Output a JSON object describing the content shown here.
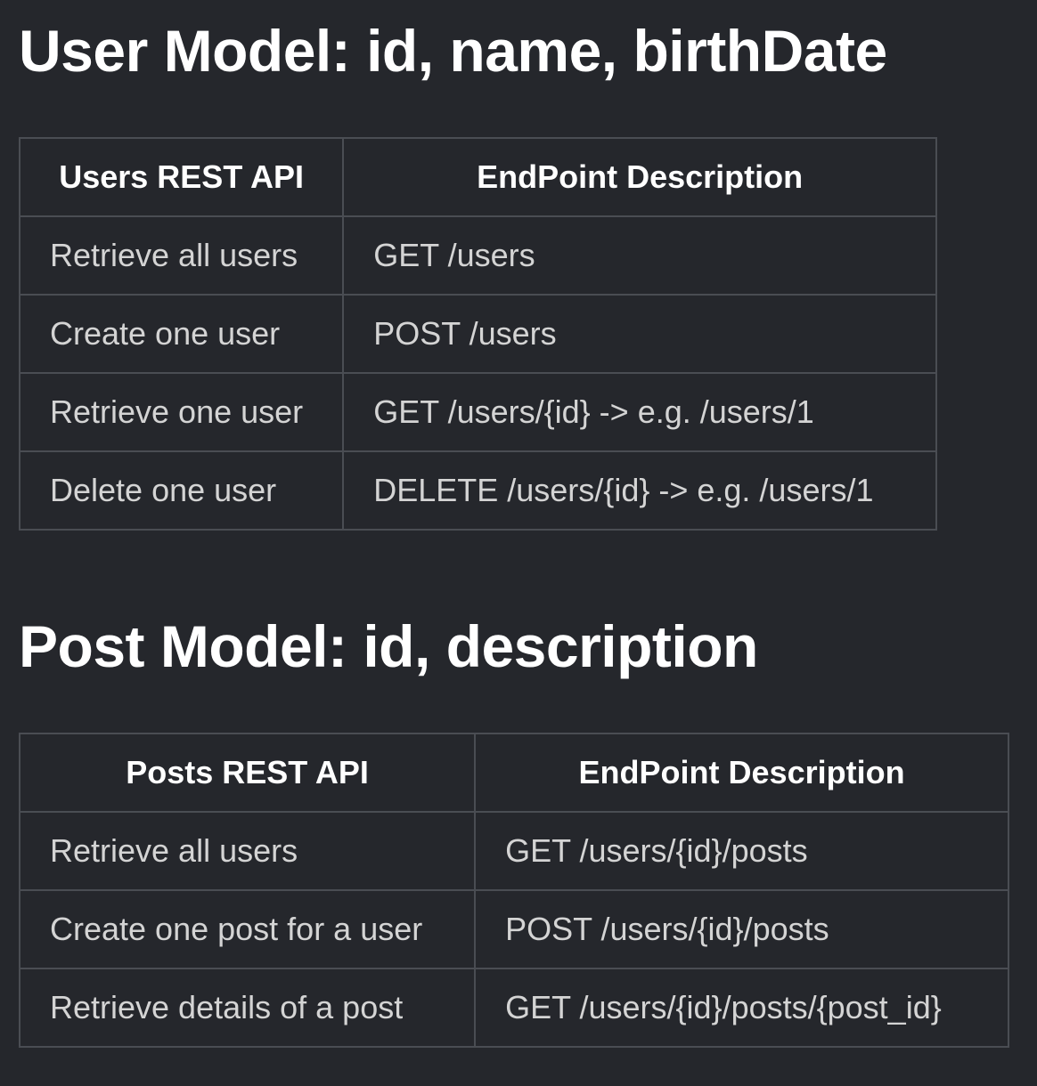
{
  "user_section": {
    "title": "User Model: id, name, birthDate",
    "table": {
      "headers": [
        "Users REST API",
        "EndPoint Description"
      ],
      "rows": [
        [
          "Retrieve all users",
          "GET /users"
        ],
        [
          "Create one user",
          "POST /users"
        ],
        [
          "Retrieve one user",
          "GET /users/{id} -> e.g. /users/1"
        ],
        [
          "Delete one user",
          "DELETE /users/{id} -> e.g. /users/1"
        ]
      ]
    }
  },
  "post_section": {
    "title": "Post Model: id, description",
    "table": {
      "headers": [
        "Posts REST API",
        "EndPoint Description"
      ],
      "rows": [
        [
          "Retrieve all users",
          "GET /users/{id}/posts"
        ],
        [
          "Create one post for a user",
          "POST /users/{id}/posts"
        ],
        [
          "Retrieve details of a post",
          "GET /users/{id}/posts/{post_id}"
        ]
      ]
    }
  }
}
